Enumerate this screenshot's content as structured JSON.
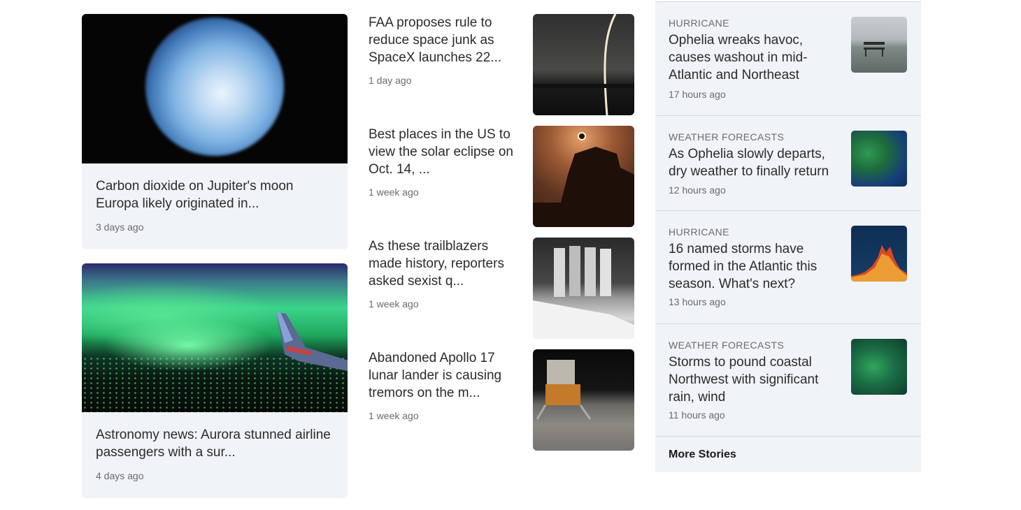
{
  "feature_cards": [
    {
      "title": "Carbon dioxide on Jupiter's moon Europa likely originated in...",
      "time": "3 days ago",
      "image": "europa-moon-photo"
    },
    {
      "title": "Astronomy news: Aurora stunned airline passengers with a sur...",
      "time": "4 days ago",
      "image": "aurora-airplane-wing-photo"
    }
  ],
  "stories": [
    {
      "title": "FAA proposes rule to reduce space junk as SpaceX launches 22...",
      "time": "1 day ago",
      "image": "rocket-launch-trail-photo"
    },
    {
      "title": "Best places in the US to view the solar eclipse on Oct. 14, ...",
      "time": "1 week ago",
      "image": "solar-eclipse-mesa-photo"
    },
    {
      "title": "As these trailblazers made history, reporters asked sexist q...",
      "time": "1 week ago",
      "image": "astronauts-space-shuttle-photo"
    },
    {
      "title": "Abandoned Apollo 17 lunar lander is causing tremors on the m...",
      "time": "1 week ago",
      "image": "apollo-lunar-lander-photo"
    }
  ],
  "sidebar": {
    "items": [
      {
        "category": "HURRICANE",
        "title": "Ophelia wreaks havoc, causes washout in mid-Atlantic and Northeast",
        "time": "17 hours ago",
        "image": "flooded-bench-photo"
      },
      {
        "category": "WEATHER FORECASTS",
        "title": "As Ophelia slowly departs, dry weather to finally return",
        "time": "12 hours ago",
        "image": "weather-map-east-coast"
      },
      {
        "category": "HURRICANE",
        "title": "16 named storms have formed in the Atlantic this season. What's next?",
        "time": "13 hours ago",
        "image": "hurricane-season-chart"
      },
      {
        "category": "WEATHER FORECASTS",
        "title": "Storms to pound coastal Northwest with significant rain, wind",
        "time": "11 hours ago",
        "image": "weather-map-northwest"
      }
    ],
    "more_label": "More Stories"
  }
}
